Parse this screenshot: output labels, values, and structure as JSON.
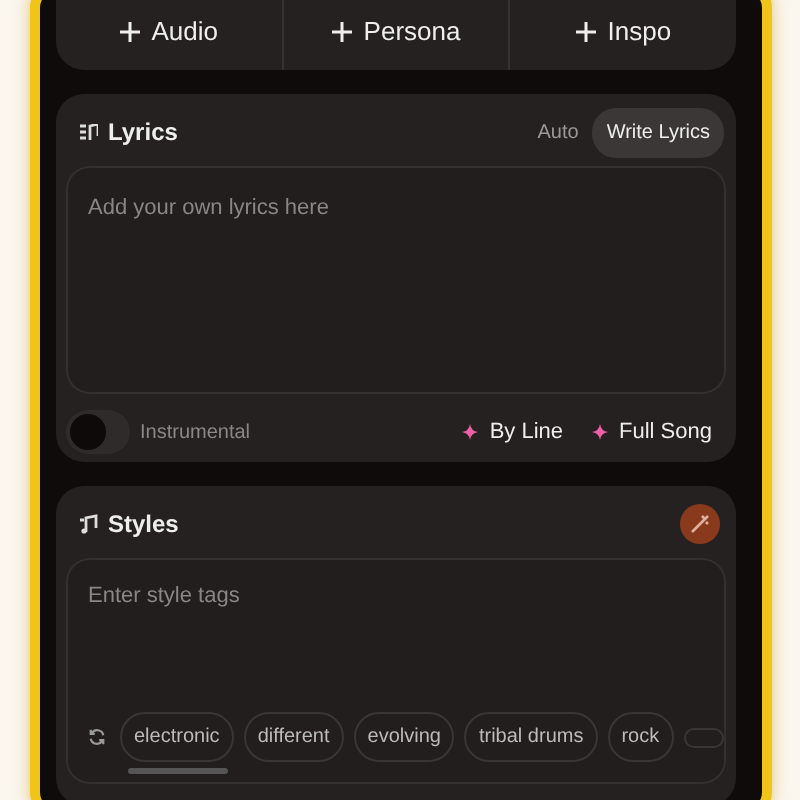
{
  "add_buttons": [
    {
      "label": "Audio"
    },
    {
      "label": "Persona"
    },
    {
      "label": "Inspo"
    }
  ],
  "lyrics": {
    "title": "Lyrics",
    "modes": [
      {
        "label": "Auto",
        "selected": false
      },
      {
        "label": "Write Lyrics",
        "selected": true
      }
    ],
    "placeholder": "Add your own lyrics here",
    "instrumental": {
      "label": "Instrumental",
      "on": false
    },
    "actions": [
      "By Line",
      "Full Song"
    ]
  },
  "styles": {
    "title": "Styles",
    "placeholder": "Enter style tags",
    "tags": [
      "electronic",
      "different",
      "evolving",
      "tribal drums",
      "rock"
    ]
  }
}
